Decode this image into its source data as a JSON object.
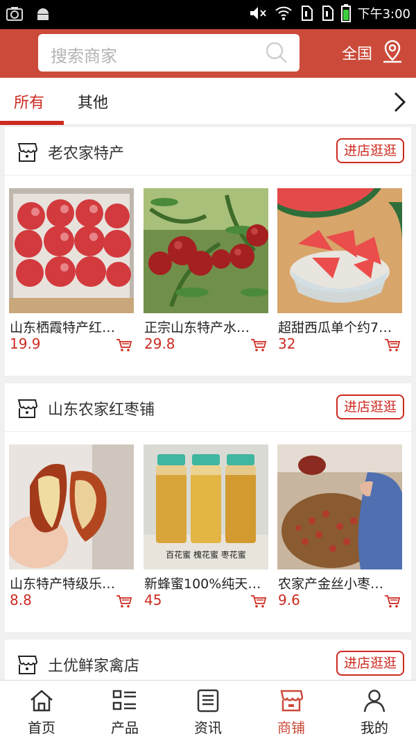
{
  "statusbar": {
    "time": "下午3:00"
  },
  "search": {
    "placeholder": "搜索商家"
  },
  "region": {
    "label": "全国"
  },
  "tabs": [
    {
      "label": "所有"
    },
    {
      "label": "其他"
    }
  ],
  "stores": [
    {
      "name": "老农家特产",
      "enter_label": "进店逛逛",
      "products": [
        {
          "name": "山东栖霞特产红…",
          "price": "19.9"
        },
        {
          "name": "正宗山东特产水…",
          "price": "29.8"
        },
        {
          "name": "超甜西瓜单个约7…",
          "price": "32"
        }
      ]
    },
    {
      "name": "山东农家红枣铺",
      "enter_label": "进店逛逛",
      "products": [
        {
          "name": "山东特产特级乐…",
          "price": "8.8"
        },
        {
          "name": "新蜂蜜100%纯天…",
          "price": "45",
          "image_text": "百花蜜 槐花蜜 枣花蜜"
        },
        {
          "name": "农家产金丝小枣…",
          "price": "9.6"
        }
      ]
    },
    {
      "name": "土优鲜家禽店",
      "enter_label": "进店逛逛"
    }
  ],
  "nav": [
    {
      "label": "首页",
      "icon": "home-icon"
    },
    {
      "label": "产品",
      "icon": "list-icon"
    },
    {
      "label": "资讯",
      "icon": "news-icon"
    },
    {
      "label": "商铺",
      "icon": "store-icon"
    },
    {
      "label": "我的",
      "icon": "user-icon"
    }
  ],
  "colors": {
    "brand": "#cc4a3a",
    "accent": "#cc2a20"
  }
}
